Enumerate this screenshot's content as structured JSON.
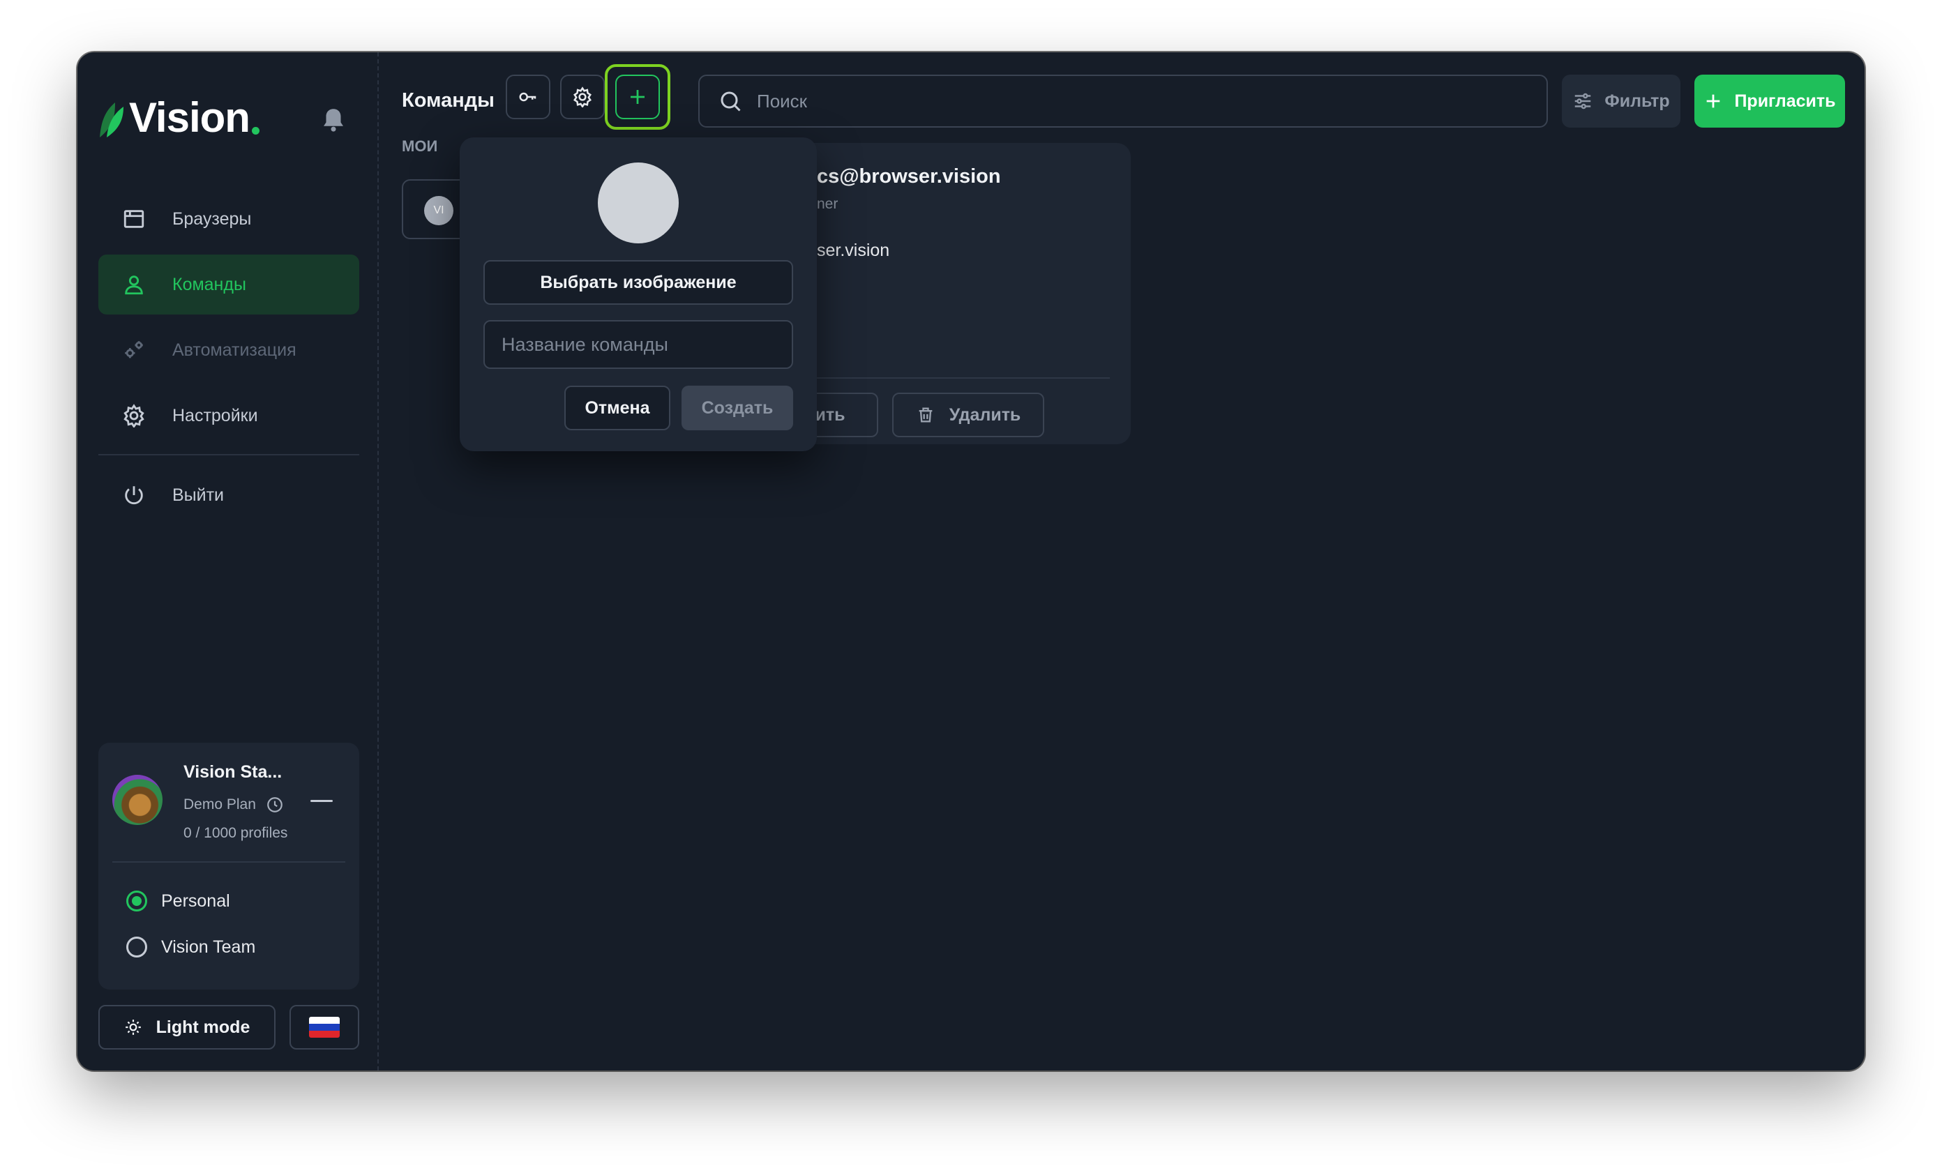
{
  "window": {
    "traffic_colors": [
      "#ff5f57",
      "#febc2e",
      "#28c840"
    ]
  },
  "brand": {
    "name": "Vision",
    "accent": "#22c55e"
  },
  "sidebar": {
    "items": [
      {
        "label": "Браузеры",
        "icon": "browser-window-icon",
        "state": "normal"
      },
      {
        "label": "Команды",
        "icon": "user-icon",
        "state": "active"
      },
      {
        "label": "Автоматизация",
        "icon": "gears-icon",
        "state": "disabled"
      },
      {
        "label": "Настройки",
        "icon": "gear-icon",
        "state": "normal"
      },
      {
        "label": "Выйти",
        "icon": "power-icon",
        "state": "normal"
      }
    ],
    "account": {
      "name": "Vision Sta...",
      "plan": "Demo Plan",
      "profiles": "0 / 1000 profiles",
      "workspaces": [
        {
          "label": "Personal",
          "selected": true
        },
        {
          "label": "Vision Team",
          "selected": false
        }
      ]
    },
    "light_mode_label": "Light mode",
    "language_flag": "russia-flag-icon"
  },
  "header": {
    "title": "Команды",
    "search_placeholder": "Поиск",
    "filter_label": "Фильтр",
    "invite_label": "Пригласить"
  },
  "main": {
    "section_label": "МОИ",
    "team_avatar_initials": "VI",
    "member": {
      "email": "cs@browser.vision",
      "role": "ner",
      "domain": "ser.vision",
      "edit_label": "ить",
      "delete_label": "Удалить"
    }
  },
  "create_team_popover": {
    "choose_image_label": "Выбрать изображение",
    "name_placeholder": "Название команды",
    "name_value": "",
    "cancel_label": "Отмена",
    "create_label": "Создать"
  }
}
